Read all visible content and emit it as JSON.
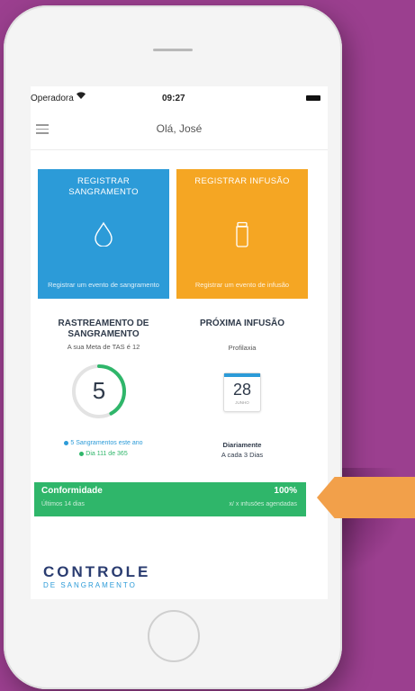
{
  "status_bar": {
    "carrier": "Operadora",
    "time": "09:27"
  },
  "header": {
    "greeting": "Olá, José"
  },
  "cards": {
    "register_bleed": {
      "title": "REGISTRAR SANGRAMENTO",
      "subtitle": "Registrar um evento de sangramento"
    },
    "register_infusion": {
      "title": "REGISTRAR INFUSÃO",
      "subtitle": "Registrar um evento de infusão"
    }
  },
  "bleed_tracking": {
    "title": "RASTREAMENTO DE SANGRAMENTO",
    "goal_text": "A sua Meta de TAS é 12",
    "count": "5",
    "progress_fraction": 0.42,
    "legend_1": "5 Sangramentos este ano",
    "legend_2": "Dia 111 de 365",
    "colors": {
      "legend_1": "#2c9bd8",
      "legend_2": "#2fb66a"
    }
  },
  "next_infusion": {
    "title": "PRÓXIMA INFUSÃO",
    "type": "Profilaxia",
    "day": "28",
    "month": "JUNHO",
    "frequency_1": "Diariamente",
    "frequency_2": "A cada 3 Dias"
  },
  "compliance": {
    "label": "Conformidade",
    "value": "100%",
    "period": "Últimos 14 dias",
    "detail": "x/ x infusões agendadas"
  },
  "logo": {
    "line1": "CONTROLE",
    "line2": "DE SANGRAMENTO"
  },
  "colors": {
    "background": "#9b3f8f",
    "blue": "#2c9bd8",
    "orange": "#f5a623",
    "green": "#2fb66a",
    "navy": "#2a3c70",
    "arrow": "#f2a04a"
  }
}
